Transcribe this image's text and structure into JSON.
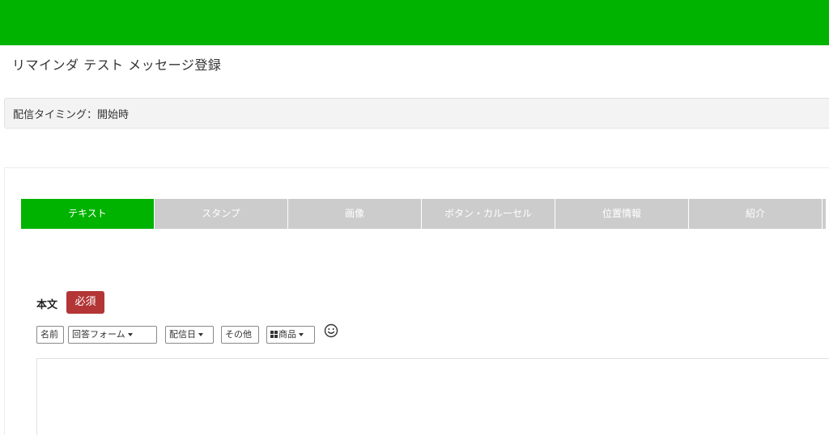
{
  "header": {
    "title": "リマインダ テスト メッセージ登録"
  },
  "timing": {
    "text": "配信タイミング：開始時"
  },
  "tabs": [
    {
      "label": "テキスト",
      "active": true
    },
    {
      "label": "スタンプ",
      "active": false
    },
    {
      "label": "画像",
      "active": false
    },
    {
      "label": "ボタン・カルーセル",
      "active": false
    },
    {
      "label": "位置情報",
      "active": false
    },
    {
      "label": "紹介",
      "active": false
    }
  ],
  "form": {
    "body_label": "本文",
    "required_label": "必須",
    "toolbar": {
      "name": "名前",
      "answer_form": "回答フォーム",
      "delivery_date": "配信日",
      "other": "その他",
      "product": "商品",
      "emoji_icon": "smiley-icon"
    },
    "body_value": ""
  },
  "colors": {
    "brand_green": "#00b300",
    "tab_inactive": "#cccccc",
    "required_red": "#b33535"
  }
}
